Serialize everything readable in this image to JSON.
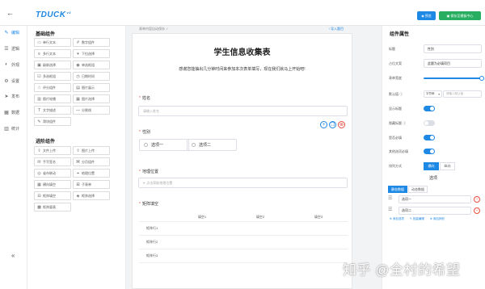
{
  "header": {
    "back_icon": "arrow-left-icon",
    "logo": "TDUCK",
    "logo_sup": "v4",
    "save_label": "预览",
    "template_label": "保存至模板中心"
  },
  "nav": {
    "items": [
      {
        "icon": "edit-icon",
        "label": "编辑"
      },
      {
        "icon": "logic-icon",
        "label": "逻辑"
      },
      {
        "icon": "appearance-icon",
        "label": "外观"
      },
      {
        "icon": "settings-icon",
        "label": "设置"
      },
      {
        "icon": "publish-icon",
        "label": "发布"
      },
      {
        "icon": "data-icon",
        "label": "数据"
      },
      {
        "icon": "stats-icon",
        "label": "统计"
      }
    ],
    "collapse_icon": "collapse-icon"
  },
  "components": {
    "basic_title": "基础组件",
    "basic": [
      {
        "icon": "▭",
        "label": "单行文本"
      },
      {
        "icon": "#",
        "label": "数字组件"
      },
      {
        "icon": "≡",
        "label": "多行文本"
      },
      {
        "icon": "▾",
        "label": "下拉选择"
      },
      {
        "icon": "▣",
        "label": "级联选择"
      },
      {
        "icon": "◉",
        "label": "单选框组"
      },
      {
        "icon": "☑",
        "label": "多选框组"
      },
      {
        "icon": "◷",
        "label": "日期时间"
      },
      {
        "icon": "☆",
        "label": "评分组件"
      },
      {
        "icon": "▤",
        "label": "图片展示"
      },
      {
        "icon": "▥",
        "label": "图片轮播"
      },
      {
        "icon": "▦",
        "label": "图片选择"
      },
      {
        "icon": "T",
        "label": "文字描述"
      },
      {
        "icon": "—",
        "label": "分割线"
      },
      {
        "icon": "✎",
        "label": "滑块组件"
      }
    ],
    "advanced_title": "进阶组件",
    "advanced": [
      {
        "icon": "⇪",
        "label": "文件上传"
      },
      {
        "icon": "⇧",
        "label": "图片上传"
      },
      {
        "icon": "✉",
        "label": "手写签名"
      },
      {
        "icon": "⌘",
        "label": "分页组件"
      },
      {
        "icon": "◎",
        "label": "省市联动"
      },
      {
        "icon": "⌖",
        "label": "地理位置"
      },
      {
        "icon": "▦",
        "label": "横向填空"
      },
      {
        "icon": "⊞",
        "label": "子表单"
      },
      {
        "icon": "⊟",
        "label": "矩阵填空"
      },
      {
        "icon": "◈",
        "label": "矩阵选择"
      },
      {
        "icon": "▩",
        "label": "矩阵量表"
      }
    ]
  },
  "form": {
    "autosave": "表单内容自动保存 ✓",
    "import": "导入题目",
    "title": "学生信息收集表",
    "description": "感谢您能抽出几分钟时间来参加本次表单填写，现在我们就马上开始吧!",
    "q1": {
      "label": "姓名",
      "placeholder": "请输入姓名"
    },
    "q2": {
      "label": "性别",
      "options": [
        "选项一",
        "选项二"
      ]
    },
    "q3": {
      "label": "地理位置",
      "placeholder": "点击获取地理位置"
    },
    "q4": {
      "label": "矩阵填空",
      "columns": [
        "填空1",
        "填空2",
        "填空3"
      ],
      "rows": [
        "矩阵行1",
        "矩阵行2",
        "矩阵行3"
      ]
    }
  },
  "props": {
    "title": "组件属性",
    "label_title": "标题",
    "title_value": "性别",
    "label_placeholder": "占位文案",
    "placeholder_value": "此题为必填项目",
    "label_width": "表单宽度",
    "label_default": "默认值",
    "default_type": "字符串",
    "default_placeholder": "请输入默认值",
    "label_show_title": "显示标题",
    "label_hide_title": "隐藏标题",
    "label_required": "是否必填",
    "label_other_required": "其他选项必填",
    "label_layout": "排列方式",
    "layout_options": [
      "横向",
      "纵向"
    ],
    "options_header": "选项",
    "options_tabs": [
      "静态数据",
      "动态数据"
    ],
    "options": [
      "选项一",
      "选项二"
    ],
    "option_links": [
      "添加选项",
      "批量编辑",
      "添加其他"
    ],
    "toggles": {
      "show_title": true,
      "hide_title": false,
      "required": true,
      "other_required": true
    }
  },
  "watermark": "知乎 @全村的希望"
}
